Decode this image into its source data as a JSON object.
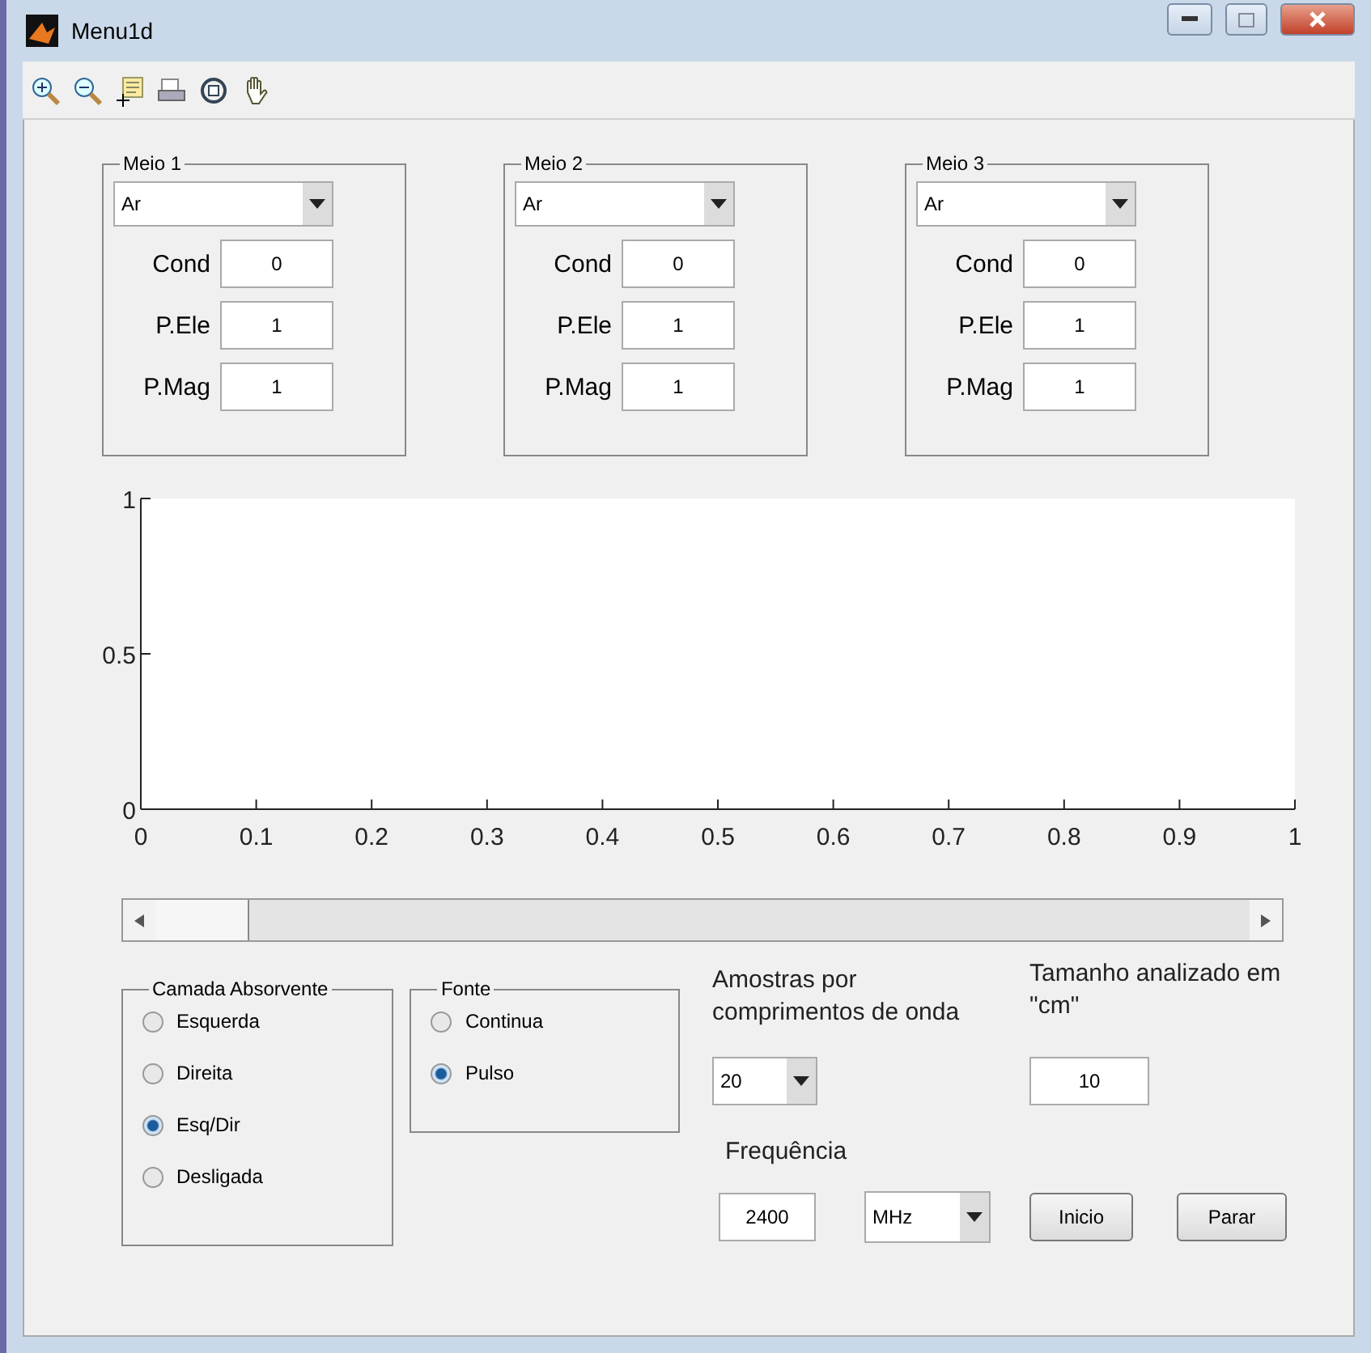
{
  "window": {
    "title": "Menu1d"
  },
  "media": [
    {
      "title": "Meio 1",
      "material": "Ar",
      "cond": {
        "label": "Cond",
        "value": "0"
      },
      "p_ele": {
        "label": "P.Ele",
        "value": "1"
      },
      "p_mag": {
        "label": "P.Mag",
        "value": "1"
      }
    },
    {
      "title": "Meio 2",
      "material": "Ar",
      "cond": {
        "label": "Cond",
        "value": "0"
      },
      "p_ele": {
        "label": "P.Ele",
        "value": "1"
      },
      "p_mag": {
        "label": "P.Mag",
        "value": "1"
      }
    },
    {
      "title": "Meio 3",
      "material": "Ar",
      "cond": {
        "label": "Cond",
        "value": "0"
      },
      "p_ele": {
        "label": "P.Ele",
        "value": "1"
      },
      "p_mag": {
        "label": "P.Mag",
        "value": "1"
      }
    }
  ],
  "plot": {
    "chart_data": {
      "type": "line",
      "xlim": [
        0,
        1
      ],
      "ylim": [
        0,
        1
      ],
      "xticks": [
        0,
        0.1,
        0.2,
        0.3,
        0.4,
        0.5,
        0.6,
        0.7,
        0.8,
        0.9,
        1
      ],
      "yticks": [
        0,
        0.5,
        1
      ]
    }
  },
  "camada": {
    "title": "Camada Absorvente",
    "options": [
      {
        "label": "Esquerda",
        "selected": false
      },
      {
        "label": "Direita",
        "selected": false
      },
      {
        "label": "Esq/Dir",
        "selected": true
      },
      {
        "label": "Desligada",
        "selected": false
      }
    ]
  },
  "fonte": {
    "title": "Fonte",
    "options": [
      {
        "label": "Continua",
        "selected": false
      },
      {
        "label": "Pulso",
        "selected": true
      }
    ]
  },
  "amostras": {
    "label": "Amostras por comprimentos de onda",
    "value": "20"
  },
  "tamanho": {
    "label": "Tamanho analizado em \"cm\"",
    "value": "10"
  },
  "frequencia": {
    "label": "Frequência",
    "value": "2400",
    "unit": "MHz"
  },
  "buttons": [
    "Inicio",
    "Parar"
  ]
}
